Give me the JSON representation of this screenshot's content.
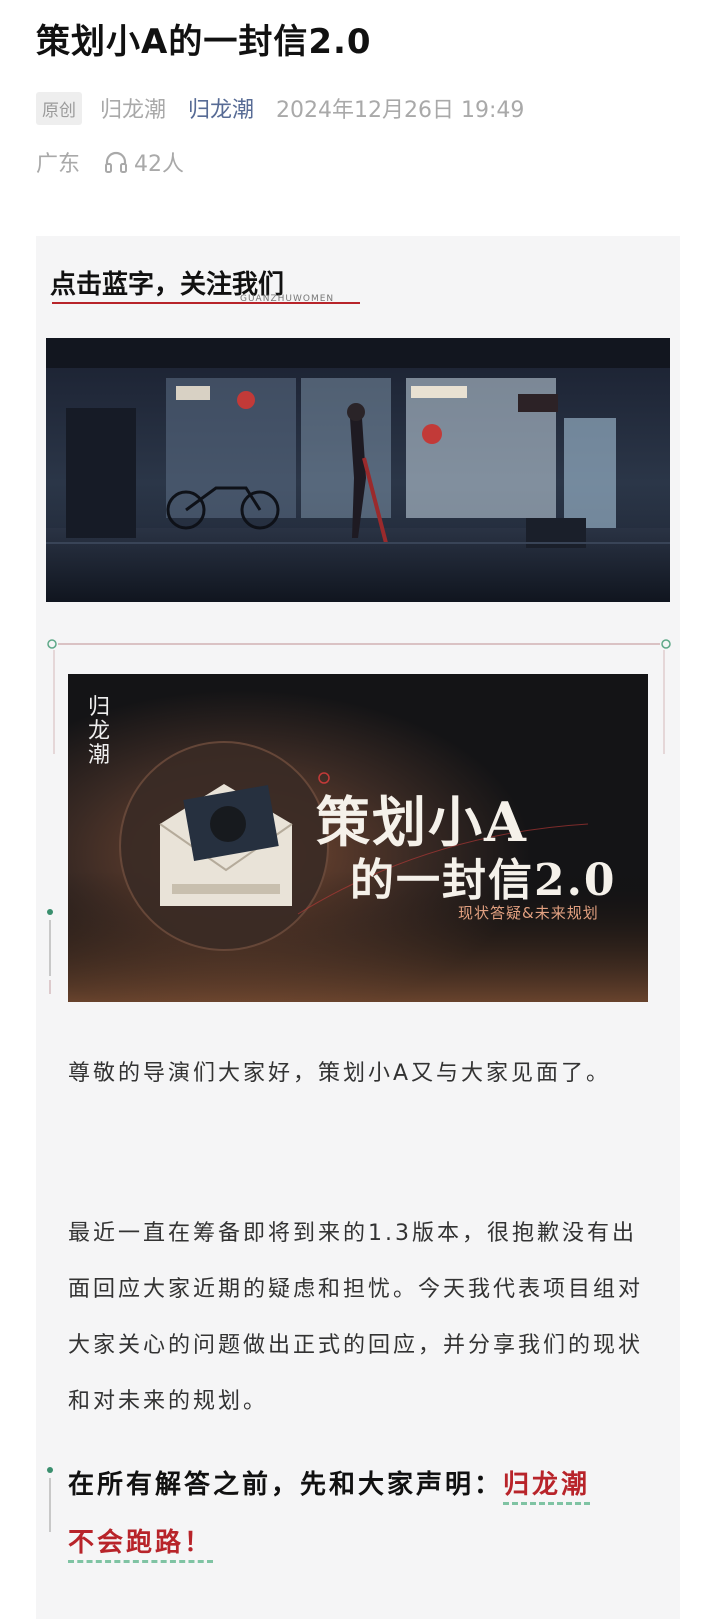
{
  "article": {
    "title": "策划小A的一封信2.0",
    "original_badge": "原创",
    "author": "归龙潮",
    "account_name": "归龙潮",
    "publish_time": "2024年12月26日 19:49",
    "location": "广东",
    "listen_count": "42人"
  },
  "follow_banner": {
    "text": "点击蓝字，关注我们",
    "sub": "GUANZHUWOMEN"
  },
  "cover_image": {
    "logo": "归龙潮",
    "title_line1": "策划小A",
    "title_line2": "的一封信2.0",
    "subtitle": "现状答疑&未来规划"
  },
  "body": {
    "paragraph1": "尊敬的导演们大家好，策划小A又与大家见面了。",
    "paragraph2": "最近一直在筹备即将到来的1.3版本，很抱歉没有出面回应大家近期的疑虑和担忧。今天我代表项目组对大家关心的问题做出正式的回应，并分享我们的现状和对未来的规划。",
    "statement_prefix": "在所有解答之前，先和大家声明：",
    "statement_highlight_1": "归龙潮",
    "statement_highlight_2": "不会跑路！"
  },
  "colors": {
    "account_link": "#576b95",
    "accent_red": "#b8242a",
    "dashed_underline": "#7fc3a3",
    "article_bg": "#f5f5f6"
  },
  "icons": {
    "listen": "headphones-icon"
  }
}
